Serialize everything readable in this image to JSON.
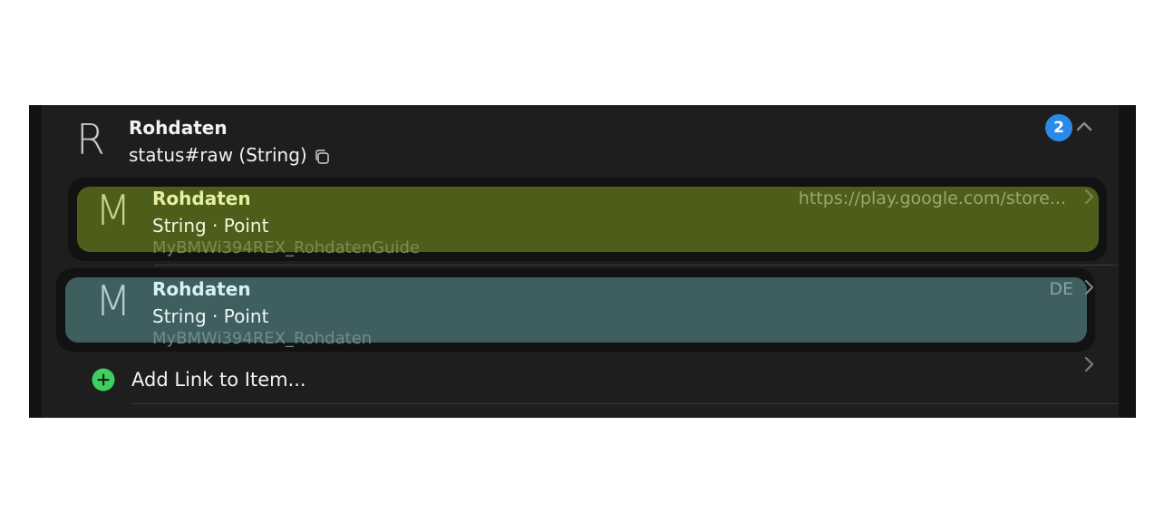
{
  "header": {
    "letter": "R",
    "title": "Rohdaten",
    "subtitle": "status#raw (String)",
    "count": "2"
  },
  "links": [
    {
      "letter": "M",
      "title": "Rohdaten",
      "subtitle": "String · Point",
      "footer": "MyBMWi394REX_RohdatenGuide",
      "right_text": "https://play.google.com/store...",
      "color": "#4d5e1a"
    },
    {
      "letter": "M",
      "title": "Rohdaten",
      "subtitle": "String · Point",
      "footer": "MyBMWi394REX_Rohdaten",
      "right_text": "DE",
      "color": "#3e5e60"
    }
  ],
  "add_link": {
    "label": "Add Link to Item...",
    "icon": "plus-circle-icon",
    "icon_color": "#3ecf5e"
  },
  "icons": {
    "copy": "copy-icon",
    "collapse": "chevron-up-icon",
    "open": "chevron-right-icon"
  },
  "colors": {
    "background": "#1e1e1e",
    "badge": "#2a8ae8"
  }
}
